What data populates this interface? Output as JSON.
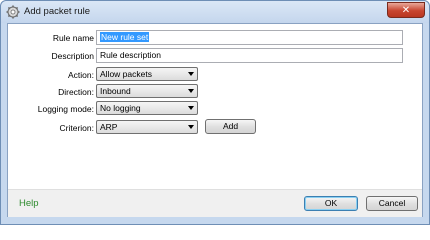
{
  "window": {
    "title": "Add packet rule",
    "close_glyph": "✕"
  },
  "form": {
    "rule_name": {
      "label": "Rule name",
      "value": "New rule set"
    },
    "description": {
      "label": "Description",
      "value": "Rule description"
    },
    "action": {
      "label": "Action:",
      "selected": "Allow packets"
    },
    "direction": {
      "label": "Direction:",
      "selected": "Inbound"
    },
    "logging_mode": {
      "label": "Logging mode:",
      "selected": "No logging"
    },
    "criterion": {
      "label": "Criterion:",
      "selected": "ARP"
    },
    "add_label": "Add"
  },
  "footer": {
    "help_label": "Help",
    "ok_label": "OK",
    "cancel_label": "Cancel"
  },
  "icons": {
    "app": "gear-icon",
    "close": "close-icon",
    "dropdown": "chevron-down-icon"
  }
}
